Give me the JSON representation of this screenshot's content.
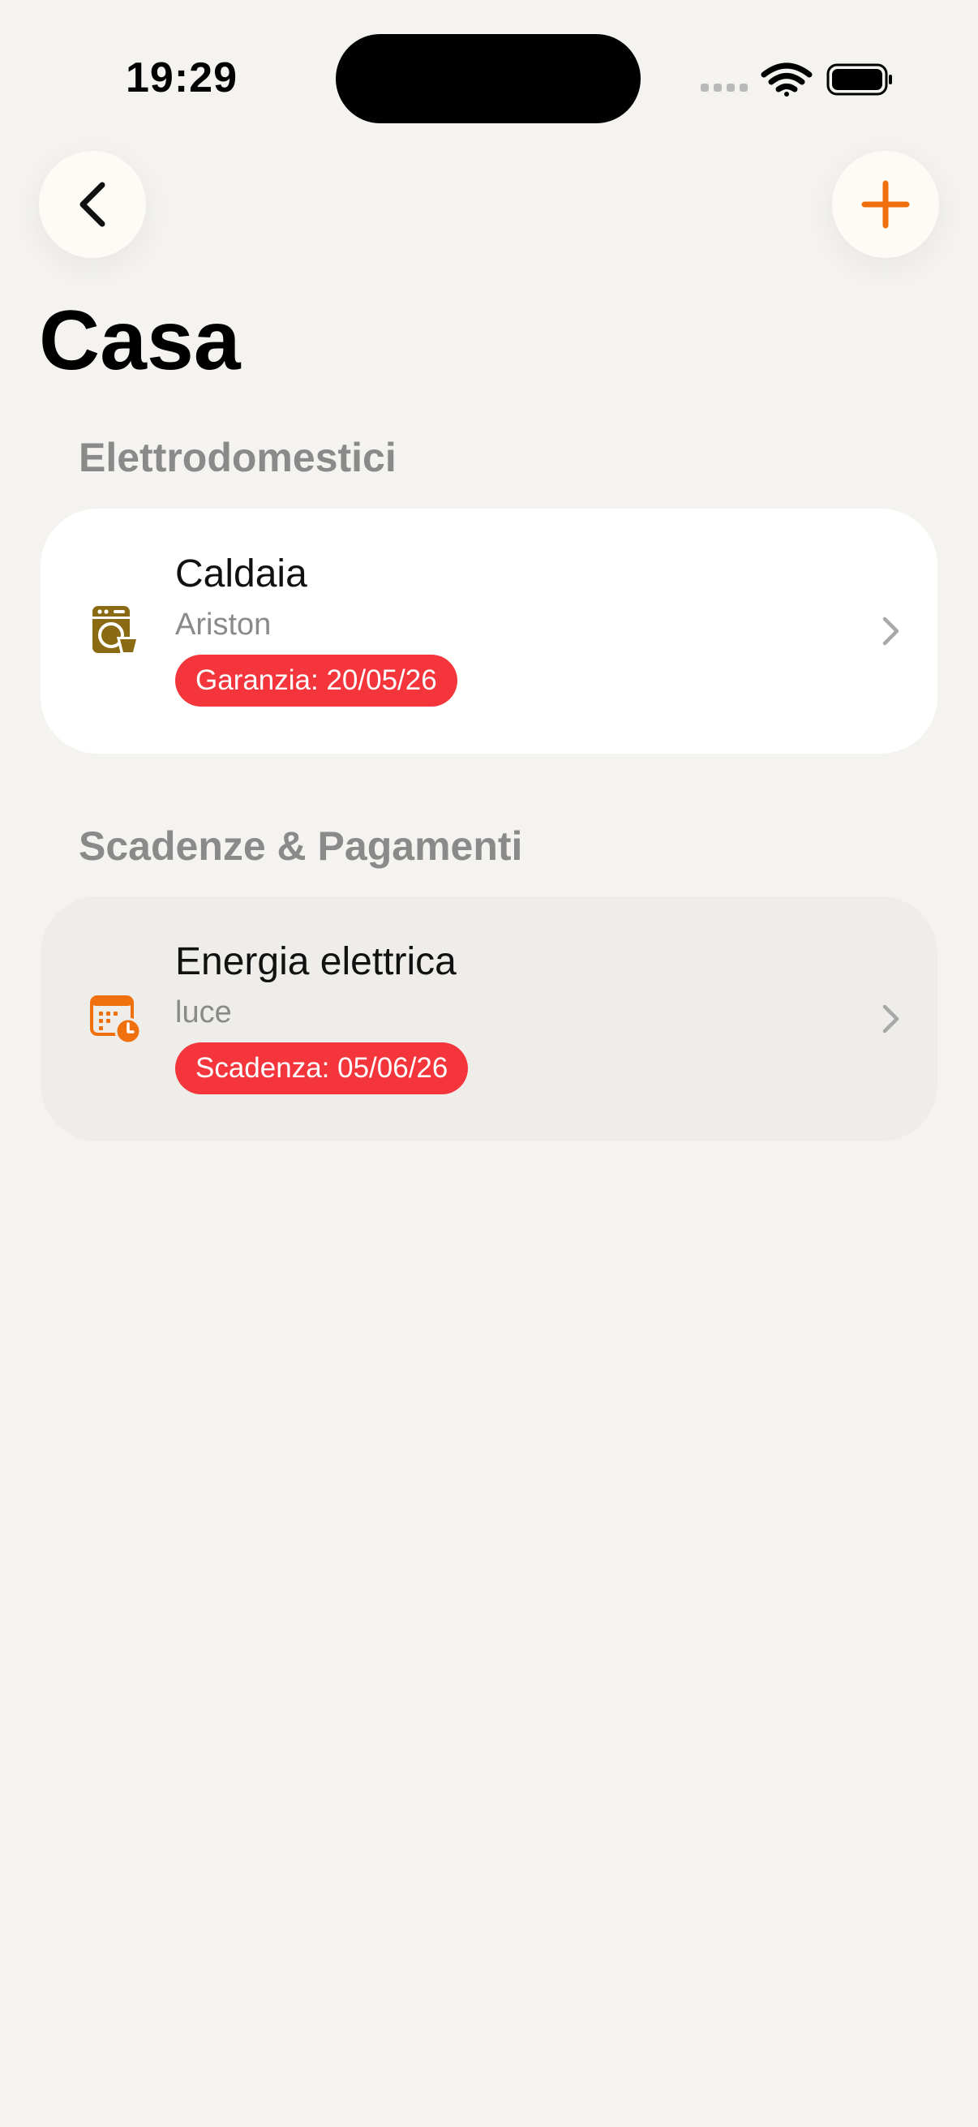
{
  "status_bar": {
    "time": "19:29"
  },
  "nav": {
    "back_icon": "chevron-left-icon",
    "add_icon": "plus-icon",
    "accent_color": "#F0700E"
  },
  "page": {
    "title": "Casa"
  },
  "sections": [
    {
      "title": "Elettrodomestici",
      "items": [
        {
          "title": "Caldaia",
          "subtitle": "Ariston",
          "badge": "Garanzia: 20/05/26",
          "icon": "washing-machine-icon",
          "icon_color": "#8A6A12"
        }
      ]
    },
    {
      "title": "Scadenze & Pagamenti",
      "items": [
        {
          "title": "Energia elettrica",
          "subtitle": "luce",
          "badge": "Scadenza: 05/06/26",
          "icon": "calendar-clock-icon",
          "icon_color": "#F0700E"
        }
      ]
    }
  ],
  "colors": {
    "background": "#F4F3F0",
    "badge_red": "#F4353B",
    "secondary_text": "#8A8A8A"
  }
}
